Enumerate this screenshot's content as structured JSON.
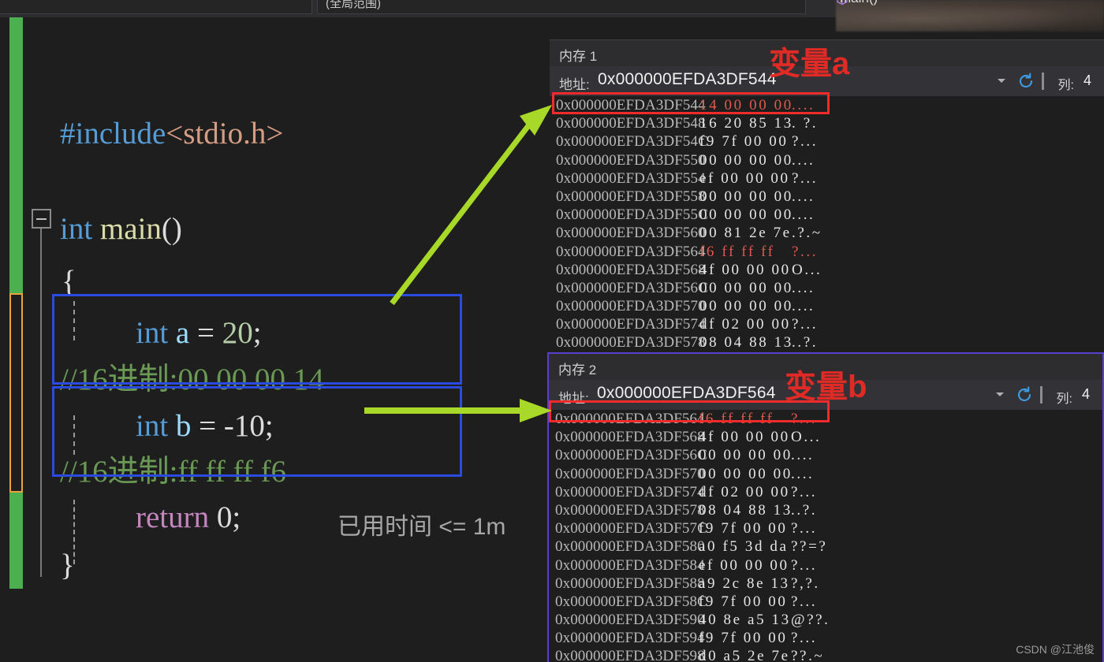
{
  "toolbar": {
    "scope_combo_value": "(全局范围)",
    "function_label": "main()"
  },
  "editor": {
    "lines": [
      {
        "id": "l1",
        "segments": [
          {
            "text": "#include",
            "color": "blue"
          },
          {
            "text": "<stdio.h>",
            "color": "orange"
          }
        ]
      },
      {
        "id": "l2",
        "segments": [
          {
            "text": "int ",
            "color": "blue"
          },
          {
            "text": "main",
            "color": "yellow"
          },
          {
            "text": "()",
            "color": "white"
          }
        ]
      },
      {
        "id": "l3",
        "segments": [
          {
            "text": "{",
            "color": "white"
          }
        ]
      },
      {
        "id": "l4",
        "segments": [
          {
            "text": "int ",
            "color": "blue"
          },
          {
            "text": "a ",
            "color": "lblue"
          },
          {
            "text": "= ",
            "color": "white"
          },
          {
            "text": "20",
            "color": "num"
          },
          {
            "text": ";",
            "color": "white"
          }
        ]
      },
      {
        "id": "l5",
        "segments": [
          {
            "text": "//16进制:00 00 00 14",
            "color": "green"
          }
        ]
      },
      {
        "id": "l6",
        "segments": [
          {
            "text": "int ",
            "color": "blue"
          },
          {
            "text": "b ",
            "color": "lblue"
          },
          {
            "text": "= ",
            "color": "white"
          },
          {
            "text": "-10",
            "color": "white"
          },
          {
            "text": ";",
            "color": "white"
          }
        ]
      },
      {
        "id": "l7",
        "segments": [
          {
            "text": "//16进制:ff ff ff f6",
            "color": "green"
          }
        ]
      },
      {
        "id": "l8",
        "segments": [
          {
            "text": "return ",
            "color": "pink"
          },
          {
            "text": "0",
            "color": "white"
          },
          {
            "text": ";",
            "color": "white"
          }
        ]
      },
      {
        "id": "l9",
        "segments": [
          {
            "text": "}",
            "color": "white"
          }
        ]
      }
    ],
    "elapsed_tip": "已用时间 <= 1m"
  },
  "annotations": {
    "variable_a": "变量a",
    "variable_b": "变量b",
    "arrow_color": "#a8d828",
    "box_color": "#2a4ae0",
    "highlight_color": "#ef2b2b",
    "annot_text_color": "#e02a26"
  },
  "memory_windows": [
    {
      "title": "内存 1",
      "address_label": "地址:",
      "address_value": "0x000000EFDA3DF544",
      "columns_label": "列:",
      "columns_value": "4",
      "refresh_icon": "refresh-icon",
      "dropdown_icon": "chevron-down-icon",
      "rows": [
        {
          "addr": "0x000000EFDA3DF544",
          "bytes": "14 00 00 00",
          "ascii": "....",
          "highlight": true
        },
        {
          "addr": "0x000000EFDA3DF548",
          "bytes": "16 20 85 13",
          "ascii": ". ?.",
          "highlight": false
        },
        {
          "addr": "0x000000EFDA3DF54C",
          "bytes": "f9 7f 00 00",
          "ascii": "?...",
          "highlight": false
        },
        {
          "addr": "0x000000EFDA3DF550",
          "bytes": "00 00 00 00",
          "ascii": "....",
          "highlight": false
        },
        {
          "addr": "0x000000EFDA3DF554",
          "bytes": "ef 00 00 00",
          "ascii": "?...",
          "highlight": false
        },
        {
          "addr": "0x000000EFDA3DF558",
          "bytes": "00 00 00 00",
          "ascii": "....",
          "highlight": false
        },
        {
          "addr": "0x000000EFDA3DF55C",
          "bytes": "00 00 00 00",
          "ascii": "....",
          "highlight": false
        },
        {
          "addr": "0x000000EFDA3DF560",
          "bytes": "00 81 2e 7e",
          "ascii": ".?.~",
          "highlight": false
        },
        {
          "addr": "0x000000EFDA3DF564",
          "bytes": "f6 ff ff ff",
          "ascii": "?...",
          "highlight": true
        },
        {
          "addr": "0x000000EFDA3DF568",
          "bytes": "4f 00 00 00",
          "ascii": "O...",
          "highlight": false
        },
        {
          "addr": "0x000000EFDA3DF56C",
          "bytes": "00 00 00 00",
          "ascii": "....",
          "highlight": false
        },
        {
          "addr": "0x000000EFDA3DF570",
          "bytes": "00 00 00 00",
          "ascii": "....",
          "highlight": false
        },
        {
          "addr": "0x000000EFDA3DF574",
          "bytes": "df 02 00 00",
          "ascii": "?...",
          "highlight": false
        },
        {
          "addr": "0x000000EFDA3DF578",
          "bytes": "08 04 88 13",
          "ascii": "..?.",
          "highlight": false
        }
      ]
    },
    {
      "title": "内存 2",
      "address_label": "地址:",
      "address_value": "0x000000EFDA3DF564",
      "columns_label": "列:",
      "columns_value": "4",
      "refresh_icon": "refresh-icon",
      "dropdown_icon": "chevron-down-icon",
      "rows": [
        {
          "addr": "0x000000EFDA3DF564",
          "bytes": "f6 ff ff ff",
          "ascii": "?...",
          "highlight": true
        },
        {
          "addr": "0x000000EFDA3DF568",
          "bytes": "4f 00 00 00",
          "ascii": "O...",
          "highlight": false
        },
        {
          "addr": "0x000000EFDA3DF56C",
          "bytes": "00 00 00 00",
          "ascii": "....",
          "highlight": false
        },
        {
          "addr": "0x000000EFDA3DF570",
          "bytes": "00 00 00 00",
          "ascii": "....",
          "highlight": false
        },
        {
          "addr": "0x000000EFDA3DF574",
          "bytes": "df 02 00 00",
          "ascii": "?...",
          "highlight": false
        },
        {
          "addr": "0x000000EFDA3DF578",
          "bytes": "08 04 88 13",
          "ascii": "..?.",
          "highlight": false
        },
        {
          "addr": "0x000000EFDA3DF57C",
          "bytes": "f9 7f 00 00",
          "ascii": "?...",
          "highlight": false
        },
        {
          "addr": "0x000000EFDA3DF580",
          "bytes": "a0 f5 3d da",
          "ascii": "??=?",
          "highlight": false
        },
        {
          "addr": "0x000000EFDA3DF584",
          "bytes": "ef 00 00 00",
          "ascii": "?...",
          "highlight": false
        },
        {
          "addr": "0x000000EFDA3DF588",
          "bytes": "a9 2c 8e 13",
          "ascii": "?,?.",
          "highlight": false
        },
        {
          "addr": "0x000000EFDA3DF58C",
          "bytes": "f9 7f 00 00",
          "ascii": "?...",
          "highlight": false
        },
        {
          "addr": "0x000000EFDA3DF590",
          "bytes": "40 8e a5 13",
          "ascii": "@??.",
          "highlight": false
        },
        {
          "addr": "0x000000EFDA3DF594",
          "bytes": "f9 7f 00 00",
          "ascii": "?...",
          "highlight": false
        },
        {
          "addr": "0x000000EFDA3DF598",
          "bytes": "d0 a5 2e 7e",
          "ascii": "??.~",
          "highlight": false
        }
      ]
    }
  ],
  "watermark": "CSDN @江池俊"
}
